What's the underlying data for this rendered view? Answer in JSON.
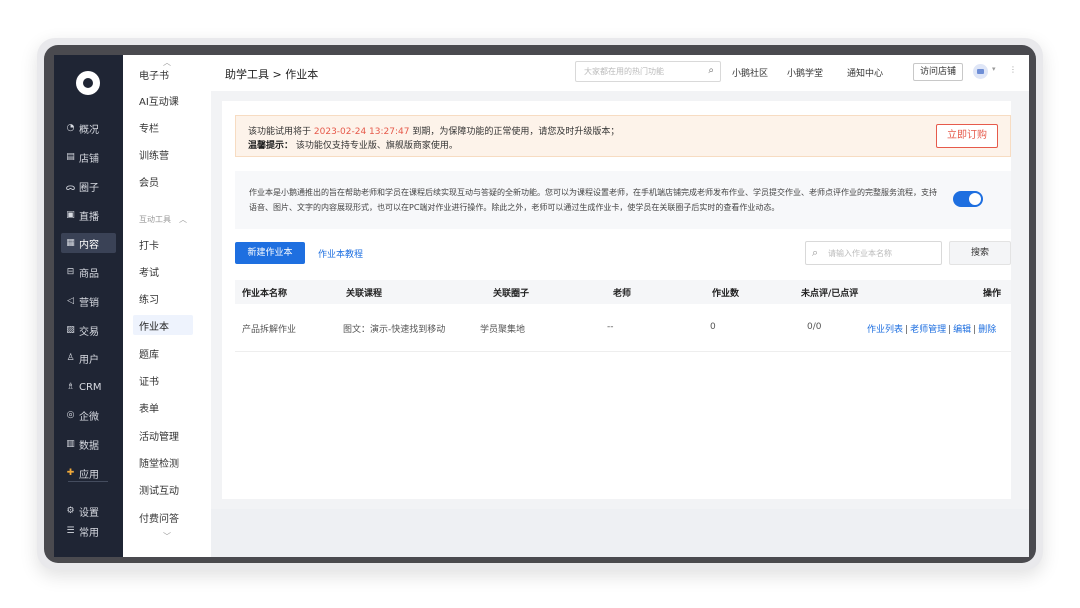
{
  "nav": {
    "items": [
      {
        "icon": "◔",
        "label": "概况",
        "icon_name": "overview-icon"
      },
      {
        "icon": "▤",
        "label": "店铺",
        "icon_name": "store-icon"
      },
      {
        "icon": "ᯅ",
        "label": "圈子",
        "icon_name": "circle-icon"
      },
      {
        "icon": "▣",
        "label": "直播",
        "icon_name": "live-icon"
      },
      {
        "icon": "▦",
        "label": "内容",
        "icon_name": "content-icon",
        "active": true
      },
      {
        "icon": "⊟",
        "label": "商品",
        "icon_name": "goods-icon"
      },
      {
        "icon": "◁",
        "label": "营销",
        "icon_name": "marketing-icon"
      },
      {
        "icon": "▨",
        "label": "交易",
        "icon_name": "trade-icon"
      },
      {
        "icon": "♙",
        "label": "用户",
        "icon_name": "user-icon"
      },
      {
        "icon": "♗",
        "label": "CRM",
        "icon_name": "crm-icon"
      },
      {
        "icon": "◎",
        "label": "企微",
        "icon_name": "wecom-icon"
      },
      {
        "icon": "▥",
        "label": "数据",
        "icon_name": "data-icon"
      },
      {
        "icon": "✚",
        "label": "应用",
        "icon_name": "apps-icon"
      }
    ],
    "bottom": [
      {
        "icon": "⚙",
        "label": "设置",
        "icon_name": "settings-icon"
      },
      {
        "icon": "☰",
        "label": "常用",
        "icon_name": "frequent-icon"
      }
    ]
  },
  "subnav": {
    "items_top": [
      "电子书",
      "AI互动课",
      "专栏",
      "训练营",
      "会员"
    ],
    "group_label": "互动工具",
    "items_group": [
      "打卡",
      "考试",
      "练习",
      "作业本",
      "题库",
      "证书",
      "表单",
      "活动管理",
      "随堂检测",
      "测试互动",
      "付费问答"
    ],
    "active": "作业本"
  },
  "header": {
    "breadcrumb": "助学工具 > 作业本",
    "search_placeholder": "大家都在用的热门功能",
    "links": [
      "小鹅社区",
      "小鹅学堂",
      "通知中心"
    ],
    "visit_store": "访问店铺"
  },
  "notice": {
    "line1_prefix": "该功能试用将于",
    "date": "2023-02-24 13:27:47",
    "line1_suffix": "到期，为保障功能的正常使用，请您及时升级版本；",
    "tip_label": "温馨提示：",
    "tip_text": "该功能仅支持专业版、旗舰版商家使用。",
    "subscribe": "立即订购"
  },
  "intro": {
    "text": "作业本是小鹅通推出的旨在帮助老师和学员在课程后续实现互动与答疑的全新功能。您可以为课程设置老师，在手机端店铺完成老师发布作业、学员提交作业、老师点评作业的完整服务流程，支持语音、图片、文字的内容展现形式，也可以在PC端对作业进行操作。除此之外，老师可以通过生成作业卡，使学员在关联圈子后实时的查看作业动态。",
    "enabled": true
  },
  "actions": {
    "new_button": "新建作业本",
    "tutorial_link": "作业本教程",
    "search_placeholder": "请输入作业本名称",
    "search_button": "搜索"
  },
  "table": {
    "headers": [
      "作业本名称",
      "关联课程",
      "关联圈子",
      "老师",
      "作业数",
      "未点评/已点评",
      "操作"
    ],
    "rows": [
      {
        "name": "产品拆解作业",
        "course": "图文：演示-快速找到移动",
        "circle": "学员聚集地",
        "teacher": "--",
        "count": "0",
        "review": "0/0",
        "ops": [
          "作业列表",
          "老师管理",
          "编辑",
          "删除"
        ]
      }
    ]
  }
}
